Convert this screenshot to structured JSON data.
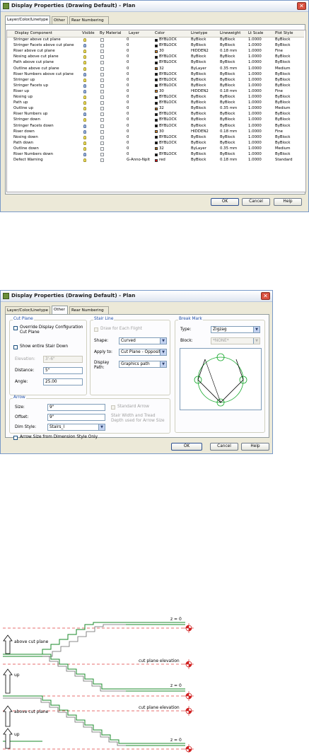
{
  "dialog1": {
    "title": "Display Properties (Drawing Default) - Plan",
    "tabs": [
      "Layer/Color/Linetype",
      "Other",
      "Rear Numbering"
    ],
    "columns": [
      "Display Component",
      "Visible",
      "By Material",
      "Layer",
      "Color",
      "Linetype",
      "Lineweight",
      "Lt Scale",
      "Plot Style"
    ],
    "rows": [
      {
        "name": "Stringer above cut plane",
        "on": true,
        "layer": "0",
        "color": "BYBLOCK",
        "swatch": "#000000",
        "linetype": "ByBlock",
        "lw": "ByBlock",
        "lts": "1.0000",
        "ps": "ByBlock"
      },
      {
        "name": "Stringer Facets above cut plane",
        "on": false,
        "layer": "0",
        "color": "BYBLOCK",
        "swatch": "#000000",
        "linetype": "ByBlock",
        "lw": "ByBlock",
        "lts": "1.0000",
        "ps": "ByBlock"
      },
      {
        "name": "Riser above cut plane",
        "on": true,
        "layer": "0",
        "color": "30",
        "swatch": "#e2861c",
        "linetype": "HIDDEN2",
        "lw": "0.18 mm",
        "lts": "1.0000",
        "ps": "Fine"
      },
      {
        "name": "Nosing above cut plane",
        "on": true,
        "layer": "0",
        "color": "BYBLOCK",
        "swatch": "#000000",
        "linetype": "ByBlock",
        "lw": "ByBlock",
        "lts": "1.0000",
        "ps": "ByBlock"
      },
      {
        "name": "Path above cut plane",
        "on": true,
        "layer": "0",
        "color": "BYBLOCK",
        "swatch": "#000000",
        "linetype": "ByBlock",
        "lw": "ByBlock",
        "lts": "1.0000",
        "ps": "ByBlock"
      },
      {
        "name": "Outline above cut plane",
        "on": true,
        "layer": "0",
        "color": "32",
        "swatch": "#b06a1a",
        "linetype": "ByLayer",
        "lw": "0.35 mm",
        "lts": "1.0000",
        "ps": "Medium"
      },
      {
        "name": "Riser Numbers above cut plane",
        "on": false,
        "layer": "0",
        "color": "BYBLOCK",
        "swatch": "#000000",
        "linetype": "ByBlock",
        "lw": "ByBlock",
        "lts": "1.0000",
        "ps": "ByBlock"
      },
      {
        "name": "Stringer up",
        "on": true,
        "layer": "0",
        "color": "BYBLOCK",
        "swatch": "#000000",
        "linetype": "ByBlock",
        "lw": "ByBlock",
        "lts": "1.0000",
        "ps": "ByBlock"
      },
      {
        "name": "Stringer Facets up",
        "on": false,
        "layer": "0",
        "color": "BYBLOCK",
        "swatch": "#000000",
        "linetype": "ByBlock",
        "lw": "ByBlock",
        "lts": "1.0000",
        "ps": "ByBlock"
      },
      {
        "name": "Riser up",
        "on": false,
        "layer": "0",
        "color": "30",
        "swatch": "#e2861c",
        "linetype": "HIDDEN2",
        "lw": "0.18 mm",
        "lts": "1.0000",
        "ps": "Fine"
      },
      {
        "name": "Nosing up",
        "on": true,
        "layer": "0",
        "color": "BYBLOCK",
        "swatch": "#000000",
        "linetype": "ByBlock",
        "lw": "ByBlock",
        "lts": "1.0000",
        "ps": "ByBlock"
      },
      {
        "name": "Path up",
        "on": true,
        "layer": "0",
        "color": "BYBLOCK",
        "swatch": "#000000",
        "linetype": "ByBlock",
        "lw": "ByBlock",
        "lts": "1.0000",
        "ps": "ByBlock"
      },
      {
        "name": "Outline up",
        "on": true,
        "layer": "0",
        "color": "32",
        "swatch": "#b06a1a",
        "linetype": "ByBlock",
        "lw": "0.35 mm",
        "lts": "1.0000",
        "ps": "Medium"
      },
      {
        "name": "Riser Numbers up",
        "on": false,
        "layer": "0",
        "color": "BYBLOCK",
        "swatch": "#000000",
        "linetype": "ByBlock",
        "lw": "ByBlock",
        "lts": "1.0000",
        "ps": "ByBlock"
      },
      {
        "name": "Stringer down",
        "on": true,
        "layer": "0",
        "color": "BYBLOCK",
        "swatch": "#000000",
        "linetype": "ByBlock",
        "lw": "ByBlock",
        "lts": "1.0000",
        "ps": "ByBlock"
      },
      {
        "name": "Stringer Facets down",
        "on": false,
        "layer": "0",
        "color": "BYBLOCK",
        "swatch": "#000000",
        "linetype": "ByBlock",
        "lw": "ByBlock",
        "lts": "1.0000",
        "ps": "ByBlock"
      },
      {
        "name": "Riser down",
        "on": false,
        "layer": "0",
        "color": "30",
        "swatch": "#e2861c",
        "linetype": "HIDDEN2",
        "lw": "0.18 mm",
        "lts": "1.0000",
        "ps": "Fine"
      },
      {
        "name": "Nosing down",
        "on": true,
        "layer": "0",
        "color": "BYBLOCK",
        "swatch": "#000000",
        "linetype": "ByBlock",
        "lw": "ByBlock",
        "lts": "1.0000",
        "ps": "ByBlock"
      },
      {
        "name": "Path down",
        "on": true,
        "layer": "0",
        "color": "BYBLOCK",
        "swatch": "#000000",
        "linetype": "ByBlock",
        "lw": "ByBlock",
        "lts": "1.0000",
        "ps": "ByBlock"
      },
      {
        "name": "Outline down",
        "on": true,
        "layer": "0",
        "color": "32",
        "swatch": "#b06a1a",
        "linetype": "ByLayer",
        "lw": "0.35 mm",
        "lts": "1.0000",
        "ps": "Medium"
      },
      {
        "name": "Riser Numbers down",
        "on": false,
        "layer": "0",
        "color": "BYBLOCK",
        "swatch": "#000000",
        "linetype": "ByBlock",
        "lw": "ByBlock",
        "lts": "1.0000",
        "ps": "ByBlock"
      },
      {
        "name": "Defect Warning",
        "on": true,
        "layer": "G-Anno-Nplt",
        "color": "red",
        "swatch": "#e01010",
        "linetype": "ByBlock",
        "lw": "0.18 mm",
        "lts": "1.0000",
        "ps": "Standard"
      }
    ],
    "buttons": {
      "ok": "OK",
      "cancel": "Cancel",
      "help": "Help"
    }
  },
  "dialog2": {
    "title": "Display Properties (Drawing Default) - Plan",
    "tabs": [
      "Layer/Color/Linetype",
      "Other",
      "Rear Numbering"
    ],
    "cut_plane": {
      "title": "Cut Plane",
      "override_label": "Override Display Configuration Cut Plane",
      "show_entire_label": "Show entire Stair Down",
      "elevation_label": "Elevation:",
      "elevation_value": "3'-6\"",
      "distance_label": "Distance:",
      "distance_value": "5\"",
      "angle_label": "Angle:",
      "angle_value": "25.00"
    },
    "stair_line": {
      "title": "Stair Line",
      "draw_flight_label": "Draw for Each Flight",
      "shape_label": "Shape:",
      "shape_value": "Curved",
      "apply_label": "Apply to:",
      "apply_value": "Cut Plane - Opposite",
      "display_path_label": "Display Path:",
      "display_path_value": "Graphics path"
    },
    "break_mark": {
      "title": "Break Mark",
      "type_label": "Type:",
      "type_value": "Zigzag",
      "block_label": "Block:",
      "block_value": "*NONE*"
    },
    "arrow": {
      "title": "Arrow",
      "size_label": "Size:",
      "size_value": "9\"",
      "offset_label": "Offset:",
      "offset_value": "9\"",
      "dimstyle_label": "Dim Style:",
      "dimstyle_value": "Stairs_I",
      "standard_arrow_label": "Standard Arrow",
      "note": "Stair Width and Tread Depth used for Arrow Size",
      "from_dimstyle_label": "Arrow Size from Dimension Style Only"
    },
    "buttons": {
      "ok": "OK",
      "cancel": "Cancel",
      "help": "Help"
    }
  },
  "diagram": {
    "labels": {
      "above1": "above cut plane",
      "up1": "up",
      "above2": "above cut plane",
      "up2": "up",
      "cut1": "cut plane elevation",
      "cut2": "cut plane elevation",
      "z1": "z = 0",
      "z2": "z = 0",
      "z3": "z = 0"
    }
  }
}
